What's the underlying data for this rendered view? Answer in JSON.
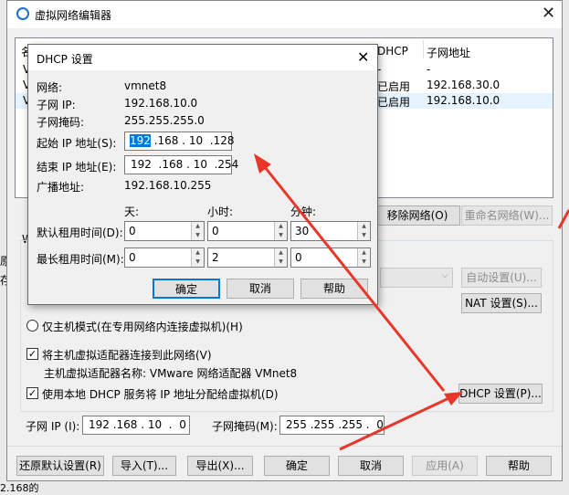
{
  "main": {
    "title": "虚拟网络编辑器",
    "close": "✕",
    "table_headers": {
      "dhcp": "DHCP",
      "subnet": "子网地址",
      "name_col_fragment": "名"
    },
    "rows": [
      {
        "prefix": "V",
        "dhcp": "-",
        "subnet": "-"
      },
      {
        "prefix": "V",
        "dhcp": "已启用",
        "subnet": "192.168.30.0"
      },
      {
        "prefix": "V",
        "dhcp": "已启用",
        "subnet": "192.168.10.0"
      }
    ],
    "remove_network": "移除网络(O)",
    "rename_network": "重命名网络(W)...",
    "auto_settings": "自动设置(U)...",
    "nat_settings": "NAT 设置(S)...",
    "host_only": "仅主机模式(在专用网络内连接虚拟机)(H)",
    "connect_adapter": "将主机虚拟适配器连接到此网络(V)",
    "adapter_name": "主机虚拟适配器名称: VMware 网络适配器 VMnet8",
    "use_dhcp": "使用本地 DHCP 服务将 IP 地址分配给虚拟机(D)",
    "dhcp_settings": "DHCP 设置(P)...",
    "subnet_ip_label": "子网 IP (I):",
    "subnet_ip": "192 .168 . 10  .  0",
    "subnet_mask_label": "子网掩码(M):",
    "subnet_mask": "255 .255 .255 .  0",
    "restore_defaults": "还原默认设置(R)",
    "import": "导入(T)...",
    "export": "导出(X)...",
    "ok": "确定",
    "cancel": "取消",
    "apply": "应用(A)",
    "help": "帮助",
    "behind_fragments": {
      "w": "W",
      "y": "原",
      "c": "存",
      "bottom": "2.168的"
    }
  },
  "dhcp_dialog": {
    "title": "DHCP 设置",
    "close": "✕",
    "network_label": "网络:",
    "network": "vmnet8",
    "subnet_ip_label": "子网 IP:",
    "subnet_ip": "192.168.10.0",
    "subnet_mask_label": "子网掩码:",
    "subnet_mask": "255.255.255.0",
    "start_ip_label": "起始 IP 地址(S):",
    "start_ip_selected": "192",
    "start_ip_rest": " .168 . 10  .128",
    "end_ip_label": "结束 IP 地址(E):",
    "end_ip": "192  .168 . 10  .254",
    "broadcast_label": "广播地址:",
    "broadcast": "192.168.10.255",
    "days_header": "天:",
    "hours_header": "小时:",
    "minutes_header": "分钟:",
    "default_lease_label": "默认租用时间(D):",
    "default_lease": {
      "days": "0",
      "hours": "0",
      "minutes": "30"
    },
    "max_lease_label": "最长租用时间(M):",
    "max_lease": {
      "days": "0",
      "hours": "2",
      "minutes": "0"
    },
    "ok": "确定",
    "cancel": "取消",
    "help": "帮助"
  },
  "colors": {
    "arrow": "#e8372a",
    "selection": "#0078d7"
  }
}
